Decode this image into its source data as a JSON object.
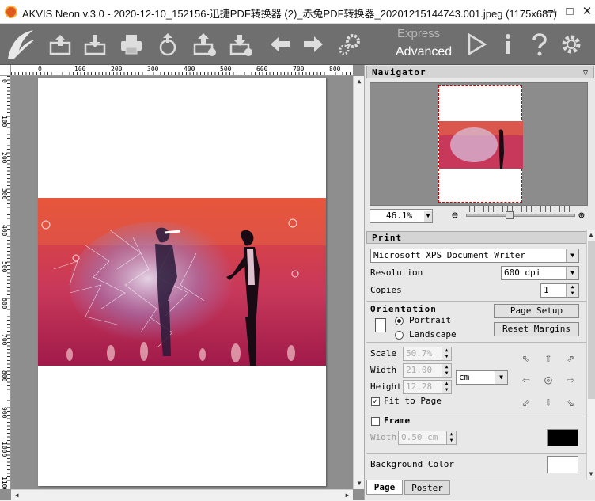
{
  "window": {
    "title": "AKVIS Neon v.3.0 - 2020-12-10_152156-迅捷PDF转换器 (2)_赤兔PDF转换器_20201215144743.001.jpeg (1175x687)",
    "minimize": "—",
    "maximize": "□",
    "close": "✕"
  },
  "toolbar": {
    "icons": [
      "logo-icon",
      "open-image-icon",
      "save-image-icon",
      "print-icon",
      "share-icon",
      "batch-icon",
      "plugin-icon",
      "undo-icon",
      "redo-icon",
      "settings-gears-icon"
    ],
    "mode_express": "Express",
    "mode_advanced": "Advanced",
    "run_icon": "play-icon",
    "info_icon": "info-icon",
    "help_icon": "help-icon",
    "prefs_icon": "gear-icon"
  },
  "rulers": {
    "top": [
      "0",
      "100",
      "200",
      "300",
      "400",
      "500",
      "600",
      "700",
      "800"
    ],
    "left": [
      "0",
      "100",
      "200",
      "300",
      "400",
      "500",
      "600",
      "700",
      "800",
      "900",
      "1000",
      "1100"
    ]
  },
  "navigator": {
    "title": "Navigator",
    "zoom": "46.1%"
  },
  "print": {
    "title": "Print",
    "printer": "Microsoft XPS Document Writer",
    "resolution_label": "Resolution",
    "resolution_value": "600 dpi",
    "copies_label": "Copies",
    "copies_value": "1",
    "orientation_label": "Orientation",
    "portrait": "Portrait",
    "landscape": "Landscape",
    "page_setup": "Page Setup",
    "reset_margins": "Reset Margins",
    "scale_label": "Scale",
    "scale_value": "50.7%",
    "width_label": "Width",
    "width_value": "21.00",
    "height_label": "Height",
    "height_value": "12.28",
    "unit": "cm",
    "fit_to_page": "Fit to Page",
    "frame_label": "Frame",
    "frame_width_label": "Width",
    "frame_width_value": "0.50 cm",
    "background_color_label": "Background Color"
  },
  "tabs": {
    "page": "Page",
    "poster": "Poster"
  },
  "colors": {
    "toolbar_bg": "#6f6f6f",
    "frame_color": "#000000",
    "background_color": "#ffffff"
  }
}
